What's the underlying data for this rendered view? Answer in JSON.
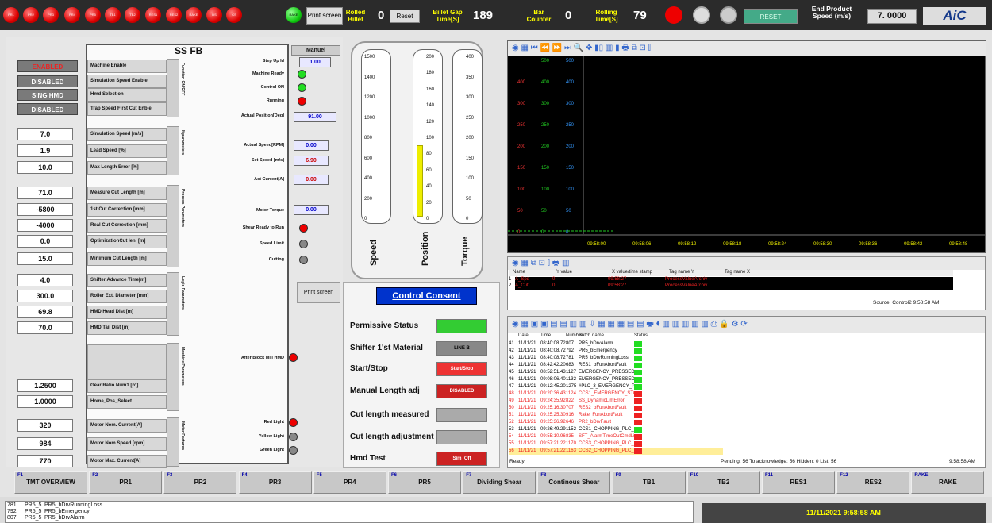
{
  "top": {
    "lamps": [
      "PR1",
      "PR2",
      "PR3",
      "PR4",
      "PR5",
      "TB1",
      "TB2",
      "RES1",
      "RES2",
      "RAKE",
      "DS",
      "CS",
      "RAKE"
    ],
    "print_screen": "Print screen",
    "rolled_billet_label": "Rolled Billet",
    "rolled_billet_value": "0",
    "reset_label": "Reset",
    "billet_gap_label": "Billet Gap Time[S]",
    "billet_gap_value": "189",
    "bar_counter_label": "Bar Counter",
    "bar_counter_value": "0",
    "rolling_time_label": "Rolling Time[S]",
    "rolling_time_value": "79",
    "reset_btn": "RESET",
    "end_speed_label": "End Product Speed (m/s)",
    "end_speed_value": "7. 0000",
    "logo": "AiC"
  },
  "ssfb": {
    "title": "SS FB",
    "status": [
      "ENABLED",
      "DISABLED",
      "SING HMD",
      "DISABLED"
    ],
    "status_labels": [
      "Machine Enable",
      "Simulation Speed Enable",
      "Hmd Selection",
      "Trap Speed First Cut Enble"
    ],
    "group1_tab": "Function ON/OFF",
    "params_a": [
      {
        "value": "7.0",
        "label": "Simulation Speed [m/s]"
      },
      {
        "value": "1.9",
        "label": "Lead Speed [%]"
      },
      {
        "value": "10.0",
        "label": "Max Length Error [%]"
      }
    ],
    "group2_tab": "Mparameters",
    "params_b": [
      {
        "value": "71.0",
        "label": "Measure Cut Length [m]"
      },
      {
        "value": "-5800",
        "label": "1st Cut Correction [mm]"
      },
      {
        "value": "-4000",
        "label": "Real Cut Correction [mm]"
      },
      {
        "value": "0.0",
        "label": "OptimizationCut len. [m]"
      },
      {
        "value": "15.0",
        "label": "Minimum Cut Length [m]"
      }
    ],
    "group3_tab": "Process Parameters",
    "params_c": [
      {
        "value": "4.0",
        "label": "Shifter Advance Time[m]"
      },
      {
        "value": "300.0",
        "label": "Roller Ext. Diameter [mm]"
      },
      {
        "value": "69.8",
        "label": "HMD Head Dist [m]"
      },
      {
        "value": "70.0",
        "label": "HMD Tail Dist [m]"
      }
    ],
    "group4_tab": "Logic Parameters",
    "group5_tab": "Machine Parameters",
    "params_d": [
      {
        "value": "1.2500",
        "label": "Gear Ratio Num1 [n°]"
      },
      {
        "value": "1.0000",
        "label": "Home_Pos_Select"
      }
    ],
    "params_e": [
      {
        "value": "320",
        "label": "Motor Nom. Current[A]"
      },
      {
        "value": "984",
        "label": "Motor Nom.Speed [rpm]"
      },
      {
        "value": "770",
        "label": "Motor Max. Current[A]"
      }
    ],
    "group6_tab": "Motor Features",
    "manual": "Manuel",
    "step_up_label": "Step Up Id",
    "step_up_value": "1.00",
    "ind": [
      {
        "label": "Machine Ready",
        "color": "grn"
      },
      {
        "label": "Control ON",
        "color": "grn"
      },
      {
        "label": "Running",
        "color": "red"
      }
    ],
    "act_pos_label": "Actual Position[Deg]",
    "act_pos_value": "91.00",
    "act_speed_label": "Actual Speed[RPM]",
    "act_speed_value": "0.00",
    "set_speed_label": "Set Speed [m/s]",
    "set_speed_value": "6.90",
    "act_current_label": "Act Current[A]",
    "act_current_value": "0.00",
    "motor_torque_label": "Motor Torque",
    "motor_torque_value": "0.00",
    "ind2": [
      {
        "label": "Shear Ready to Run",
        "color": "red"
      },
      {
        "label": "Speed Limit",
        "color": "gry"
      },
      {
        "label": "Cutting",
        "color": "gry"
      }
    ],
    "after_block": "After Block Mill HMD",
    "lights": [
      {
        "label": "Red Light",
        "color": "red"
      },
      {
        "label": "Yellow Light",
        "color": "gry"
      },
      {
        "label": "Green Light",
        "color": "gry"
      }
    ]
  },
  "gauges": {
    "speed": {
      "label": "Speed",
      "ticks": [
        "1500",
        "1400",
        "1200",
        "1000",
        "800",
        "600",
        "400",
        "200",
        "0"
      ],
      "fill": 0
    },
    "position": {
      "label": "Position",
      "ticks": [
        "200",
        "180",
        "160",
        "140",
        "120",
        "100",
        "80",
        "60",
        "40",
        "20",
        "0"
      ],
      "fill": 0.45
    },
    "torque": {
      "label": "Torque",
      "ticks": [
        "400",
        "350",
        "300",
        "250",
        "200",
        "150",
        "100",
        "50",
        "0"
      ],
      "fill": 0
    }
  },
  "consent": {
    "print_screen": "Print screen",
    "title": "Control Consent",
    "rows": [
      {
        "label": "Permissive Status",
        "value": "",
        "color": "#3c3"
      },
      {
        "label": "Shifter 1'st Material",
        "value": "LINE B",
        "color": "#888"
      },
      {
        "label": "Start/Stop",
        "value": "Start/Stop",
        "color": "#e33"
      },
      {
        "label": "Manual Length adj",
        "value": "DISABLED",
        "color": "#c22"
      },
      {
        "label": "Cut length measured",
        "value": "",
        "color": "#aaa"
      },
      {
        "label": "Cut length adjustment",
        "value": "",
        "color": "#aaa"
      },
      {
        "label": "Hmd Test",
        "value": "Sim_Off",
        "color": "#c22"
      }
    ]
  },
  "trend": {
    "times": [
      "09:58:00",
      "09:58:06",
      "09:58:12",
      "09:58:18",
      "09:58:24",
      "09:58:30",
      "09:58:36",
      "09:58:42",
      "09:58:48"
    ],
    "scales": [
      "500",
      "400",
      "300",
      "250",
      "200",
      "150",
      "100",
      "50",
      "0"
    ],
    "tag_headers": [
      "Name",
      "Y value",
      "X value/time stamp",
      "Tag name Y",
      "Tag name X"
    ],
    "tags": [
      {
        "name": "A_Spd",
        "y": "0",
        "x": "09:58:27",
        "tn": "ProcessValueArchiv"
      },
      {
        "name": "A_Cut",
        "y": "0",
        "x": "09:58:27",
        "tn": "ProcessValueArchiv"
      }
    ],
    "source": "Source: Control2 9:58:58 AM"
  },
  "alarms": {
    "headers": [
      "Date",
      "Time",
      "Number",
      "Batch name",
      "Status"
    ],
    "rows": [
      {
        "n": "41",
        "d": "11/11/21",
        "t": "08:40:08.72",
        "num": "807",
        "b": "PR5_bDrvAlarm",
        "red": false
      },
      {
        "n": "42",
        "d": "11/11/21",
        "t": "08:40:08.72",
        "num": "792",
        "b": "PR5_bEmergency",
        "red": false
      },
      {
        "n": "43",
        "d": "11/11/21",
        "t": "08:40:08.72",
        "num": "781",
        "b": "PR5_bDrvRunningLoss",
        "red": false
      },
      {
        "n": "44",
        "d": "11/11/21",
        "t": "08:42:42.20",
        "num": "683",
        "b": "RES1_bFunAbortFault",
        "red": false
      },
      {
        "n": "45",
        "d": "11/11/21",
        "t": "08:52:51.43",
        "num": "1127",
        "b": "EMERGENCY_PRESSED_BCF",
        "red": false
      },
      {
        "n": "46",
        "d": "11/11/21",
        "t": "09:08:06.40",
        "num": "1132",
        "b": "EMERGENCY_PRESSED_BCF",
        "red": false
      },
      {
        "n": "47",
        "d": "11/11/21",
        "t": "09:12:45.20",
        "num": "1275",
        "b": "#PLC_3_EMERGENCY_PRES",
        "red": false
      },
      {
        "n": "48",
        "d": "11/11/21",
        "t": "09:20:36.43",
        "num": "1124",
        "b": "CCS1_EMERGENCY_STOP_P",
        "red": true
      },
      {
        "n": "49",
        "d": "11/11/21",
        "t": "09:24:35.92",
        "num": "822",
        "b": "SS_DynamicLimError",
        "red": true
      },
      {
        "n": "50",
        "d": "11/11/21",
        "t": "09:25:16.30",
        "num": "707",
        "b": "RES2_bFunAbortFault",
        "red": true
      },
      {
        "n": "51",
        "d": "11/11/21",
        "t": "09:25:25.30",
        "num": "916",
        "b": "Rake_FunAbortFault",
        "red": true
      },
      {
        "n": "52",
        "d": "11/11/21",
        "t": "09:25:36.92",
        "num": "646",
        "b": "PR2_bDrvFault",
        "red": true
      },
      {
        "n": "53",
        "d": "11/11/21",
        "t": "09:26:49.29",
        "num": "1152",
        "b": "CCS1_CHOPPING_PLC_2_D",
        "red": false
      },
      {
        "n": "54",
        "d": "11/11/21",
        "t": "09:55:10.96",
        "num": "835",
        "b": "SFT_AlarmTimeOutCmdLine",
        "red": true
      },
      {
        "n": "55",
        "d": "11/11/21",
        "t": "09:57:21.22",
        "num": "1170",
        "b": "CCS3_CHOPPING_PLC_2_DE",
        "red": true
      },
      {
        "n": "56",
        "d": "11/11/21",
        "t": "09:57:21.22",
        "num": "1163",
        "b": "CCS2_CHOPPING_PLC_2_DE",
        "red": true
      }
    ],
    "ready": "Ready",
    "footer": "Pending: 56  To acknowledge: 56  Hidden: 0  List: 56",
    "time": "9:58:58 AM"
  },
  "fkeys": [
    {
      "k": "F1",
      "t": "TMT OVERVIEW"
    },
    {
      "k": "F2",
      "t": "PR1"
    },
    {
      "k": "F3",
      "t": "PR2"
    },
    {
      "k": "F4",
      "t": "PR3"
    },
    {
      "k": "F5",
      "t": "PR4"
    },
    {
      "k": "F6",
      "t": "PR5"
    },
    {
      "k": "F7",
      "t": "Dividing Shear"
    },
    {
      "k": "F8",
      "t": "Continous Shear"
    },
    {
      "k": "F9",
      "t": "TB1"
    },
    {
      "k": "F10",
      "t": "TB2"
    },
    {
      "k": "F11",
      "t": "RES1"
    },
    {
      "k": "F12",
      "t": "RES2"
    },
    {
      "k": "RAKE",
      "t": "RAKE"
    }
  ],
  "bottom": {
    "rows": [
      [
        "781",
        "PR5_5",
        "PR5_bDrvRunningLoss"
      ],
      [
        "792",
        "PR5_5",
        "PR5_bEmergency"
      ],
      [
        "807",
        "PR5_5",
        "PR5_bDrvAlarm"
      ]
    ],
    "datetime": "11/11/2021 9:58:58 AM"
  },
  "colors": {
    "alarm_red": "#e22",
    "ok_green": "#2d2",
    "accent_blue": "#0033cc"
  }
}
